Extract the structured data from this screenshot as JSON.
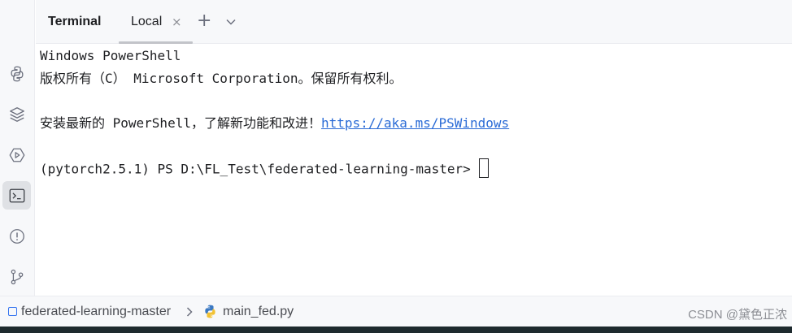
{
  "tool_window": {
    "title": "Terminal",
    "tabs": [
      {
        "label": "Local",
        "close_glyph": "×"
      }
    ],
    "add_tab_glyph": "+"
  },
  "sidebar": {
    "items": [
      {
        "icon": "python-console-icon",
        "active": false
      },
      {
        "icon": "layers-icon",
        "active": false
      },
      {
        "icon": "services-icon",
        "active": false
      },
      {
        "icon": "terminal-icon",
        "active": true
      },
      {
        "icon": "problems-icon",
        "active": false
      },
      {
        "icon": "git-icon",
        "active": false
      }
    ]
  },
  "terminal": {
    "line1": "Windows PowerShell",
    "line2": "版权所有（C） Microsoft Corporation。保留所有权利。",
    "line3_text": "安装最新的 PowerShell，了解新功能和改进！",
    "line3_link": "https://aka.ms/PSWindows",
    "prompt": "(pytorch2.5.1) PS D:\\FL_Test\\federated-learning-master>"
  },
  "breadcrumb": {
    "project": "federated-learning-master",
    "file": "main_fed.py"
  },
  "watermark": "CSDN @黛色正浓",
  "colors": {
    "link": "#2a6bd6",
    "accent": "#3574f0",
    "panel_bg": "#f7f8fa"
  }
}
